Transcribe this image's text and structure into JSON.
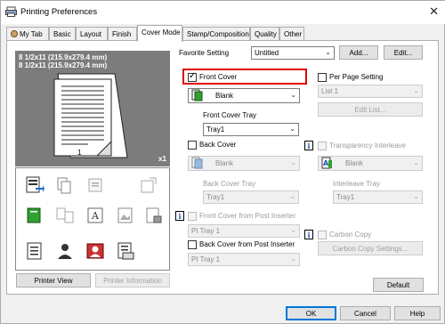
{
  "window": {
    "title": "Printing Preferences",
    "close_glyph": "✕"
  },
  "tabs": [
    {
      "label": "My Tab"
    },
    {
      "label": "Basic"
    },
    {
      "label": "Layout"
    },
    {
      "label": "Finish"
    },
    {
      "label": "Cover Mode"
    },
    {
      "label": "Stamp/Composition"
    },
    {
      "label": "Quality"
    },
    {
      "label": "Other"
    }
  ],
  "preview": {
    "paper_line1": "8 1/2x11 (215.9x279.4 mm)",
    "paper_line2": "8 1/2x11 (215.9x279.4 mm)",
    "copies": "x1",
    "page_number": "1"
  },
  "favorite": {
    "label": "Favorite Setting",
    "value": "Untitled",
    "add_label": "Add...",
    "edit_label": "Edit..."
  },
  "front_cover": {
    "checkbox_label": "Front Cover",
    "checked": true,
    "type_value": "Blank",
    "tray_label": "Front Cover Tray",
    "tray_value": "Tray1"
  },
  "back_cover": {
    "checkbox_label": "Back Cover",
    "checked": false,
    "type_value": "Blank",
    "tray_label": "Back Cover Tray",
    "tray_value": "Tray1"
  },
  "front_post_inserter": {
    "checkbox_label": "Front Cover from Post Inserter",
    "tray_value": "PI Tray 1"
  },
  "back_post_inserter": {
    "checkbox_label": "Back Cover from Post Inserter",
    "tray_value": "PI Tray 1"
  },
  "per_page": {
    "checkbox_label": "Per Page Setting",
    "list_value": "List 1",
    "edit_list_label": "Edit List..."
  },
  "transparency": {
    "checkbox_label": "Transparency Interleave",
    "type_value": "Blank",
    "tray_label": "Interleave Tray",
    "tray_value": "Tray1"
  },
  "carbon_copy": {
    "checkbox_label": "Carbon Copy",
    "settings_label": "Carbon Copy Settings..."
  },
  "preview_buttons": {
    "printer_view": "Printer View",
    "printer_information": "Printer Information"
  },
  "default_label": "Default",
  "dialog_buttons": {
    "ok": "OK",
    "cancel": "Cancel",
    "help": "Help"
  },
  "colors": {
    "highlight": "#e00000",
    "preview_bg": "#7c7c7c",
    "accent": "#0078d7"
  }
}
